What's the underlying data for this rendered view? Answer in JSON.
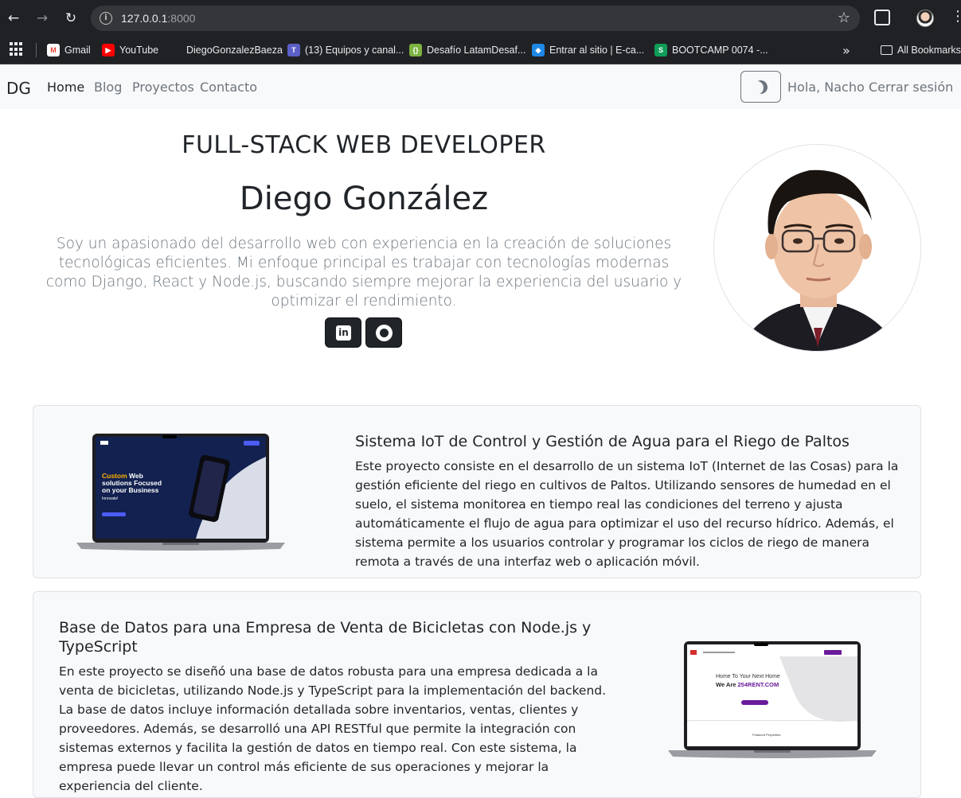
{
  "browser": {
    "url_host": "127.0.0.1",
    "url_port": ":8000",
    "bookmarks": [
      {
        "label": "Gmail",
        "color": "#ea4335"
      },
      {
        "label": "YouTube",
        "color": "#ff0000"
      },
      {
        "label": "DiegoGonzalezBaeza",
        "color": "#202124"
      },
      {
        "label": "(13) Equipos y canal...",
        "color": "#5b5fc7"
      },
      {
        "label": "Desafío LatamDesaf...",
        "color": "#7cb342"
      },
      {
        "label": "Entrar al sitio | E-ca...",
        "color": "#1e88e5"
      },
      {
        "label": "BOOTCAMP 0074 -...",
        "color": "#0f9d58"
      }
    ],
    "all_bookmarks": "All Bookmarks",
    "more": "»"
  },
  "navbar": {
    "brand": "DG",
    "links": [
      "Home",
      "Blog",
      "Proyectos",
      "Contacto"
    ],
    "greeting": "Hola, Nacho",
    "logout": "Cerrar sesión"
  },
  "hero": {
    "subtitle": "FULL-STACK WEB DEVELOPER",
    "name": "Diego González",
    "bio": "Soy un apasionado del desarrollo web con experiencia en la creación de soluciones tecnológicas eficientes. Mi enfoque principal es trabajar con tecnologías modernas como Django, React y Node.js, buscando siempre mejorar la experiencia del usuario y optimizar el rendimiento."
  },
  "projects": [
    {
      "title": "Sistema IoT de Control y Gestión de Agua para el Riego de Paltos",
      "text": "Este proyecto consiste en el desarrollo de un sistema IoT (Internet de las Cosas) para la gestión eficiente del riego en cultivos de Paltos. Utilizando sensores de humedad en el suelo, el sistema monitorea en tiempo real las condiciones del terreno y ajusta automáticamente el flujo de agua para optimizar el uso del recurso hídrico. Además, el sistema permite a los usuarios controlar y programar los ciclos de riego de manera remota a través de una interfaz web o aplicación móvil.",
      "screen_text": [
        "Custom Web",
        "solutions Focused",
        "on your Business",
        "Innovate!"
      ]
    },
    {
      "title": "Base de Datos para una Empresa de Venta de Bicicletas con Node.js y TypeScript",
      "text": "En este proyecto se diseñó una base de datos robusta para una empresa dedicada a la venta de bicicletas, utilizando Node.js y TypeScript para la implementación del backend. La base de datos incluye información detallada sobre inventarios, ventas, clientes y proveedores. Además, se desarrolló una API RESTful que permite la integración con sistemas externos y facilita la gestión de datos en tiempo real. Con este sistema, la empresa puede llevar un control más eficiente de sus operaciones y mejorar la experiencia del cliente.",
      "screen_text": [
        "Home To Your Next Home",
        "We Are 254RENT.COM",
        "Featured Properties"
      ]
    }
  ]
}
